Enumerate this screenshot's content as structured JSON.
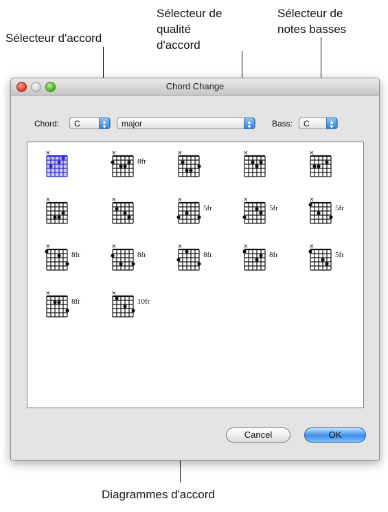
{
  "callouts": {
    "chord_selector": "Sélecteur d'accord",
    "quality_selector_l1": "Sélecteur de",
    "quality_selector_l2": "qualité",
    "quality_selector_l3": "d'accord",
    "bass_selector_l1": "Sélecteur de",
    "bass_selector_l2": "notes basses",
    "diagrams": "Diagrammes d'accord"
  },
  "window": {
    "title": "Chord Change"
  },
  "controls": {
    "chord_label": "Chord:",
    "chord_value": "C",
    "quality_value": "major",
    "bass_label": "Bass:",
    "bass_value": "C"
  },
  "diagrams": [
    {
      "fret": "",
      "selected": true
    },
    {
      "fret": "8fr",
      "selected": false
    },
    {
      "fret": "",
      "selected": false
    },
    {
      "fret": "",
      "selected": false
    },
    {
      "fret": "",
      "selected": false
    },
    {
      "fret": "",
      "selected": false
    },
    {
      "fret": "",
      "selected": false
    },
    {
      "fret": "5fr",
      "selected": false
    },
    {
      "fret": "5fr",
      "selected": false
    },
    {
      "fret": "5fr",
      "selected": false
    },
    {
      "fret": "8fr",
      "selected": false
    },
    {
      "fret": "8fr",
      "selected": false
    },
    {
      "fret": "8fr",
      "selected": false
    },
    {
      "fret": "8fr",
      "selected": false
    },
    {
      "fret": "5fr",
      "selected": false
    },
    {
      "fret": "8fr",
      "selected": false
    },
    {
      "fret": "10fr",
      "selected": false
    }
  ],
  "buttons": {
    "cancel": "Cancel",
    "ok": "OK"
  },
  "colors": {
    "selected_diagram": "#2c2ccf",
    "ok_button": "#3d8de6",
    "close_light": "#d6382c"
  }
}
